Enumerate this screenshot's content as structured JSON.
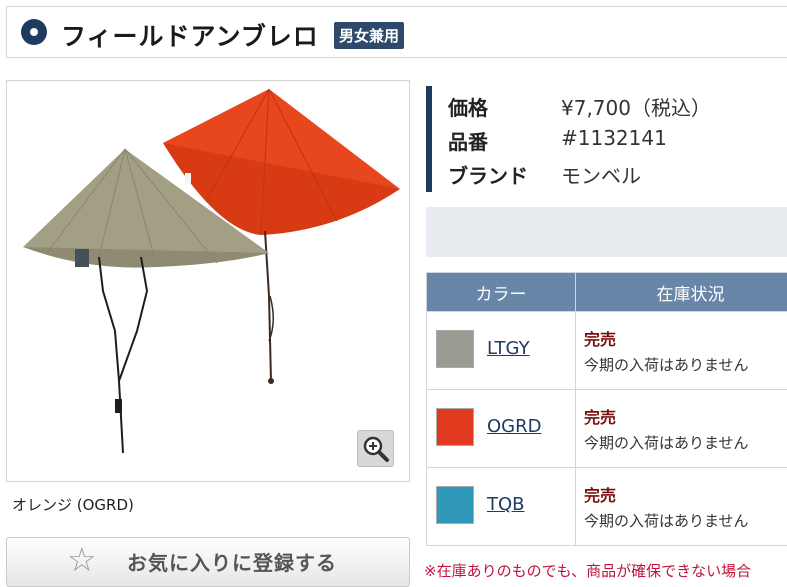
{
  "header": {
    "title": "フィールドアンブレロ",
    "badge": "男女兼用"
  },
  "product_image": {
    "caption": "オレンジ (OGRD)"
  },
  "favorite_button": {
    "label": "お気に入りに登録する",
    "icon": "star-outline-icon"
  },
  "spec": {
    "price_label": "価格",
    "price_value": "¥7,700（税込）",
    "sku_label": "品番",
    "sku_value": "#1132141",
    "brand_label": "ブランド",
    "brand_value": "モンベル"
  },
  "stock_table": {
    "headers": [
      "カラー",
      "在庫状況"
    ],
    "rows": [
      {
        "code": "LTGY",
        "swatch": "#9b9a91",
        "status": "完売",
        "note": "今期の入荷はありません"
      },
      {
        "code": "OGRD",
        "swatch": "#e23a1e",
        "status": "完売",
        "note": "今期の入荷はありません"
      },
      {
        "code": "TQB",
        "swatch": "#2f97b8",
        "status": "完売",
        "note": "今期の入荷はありません"
      }
    ]
  },
  "footnote": "※在庫ありのものでも、商品が確保できない場合"
}
